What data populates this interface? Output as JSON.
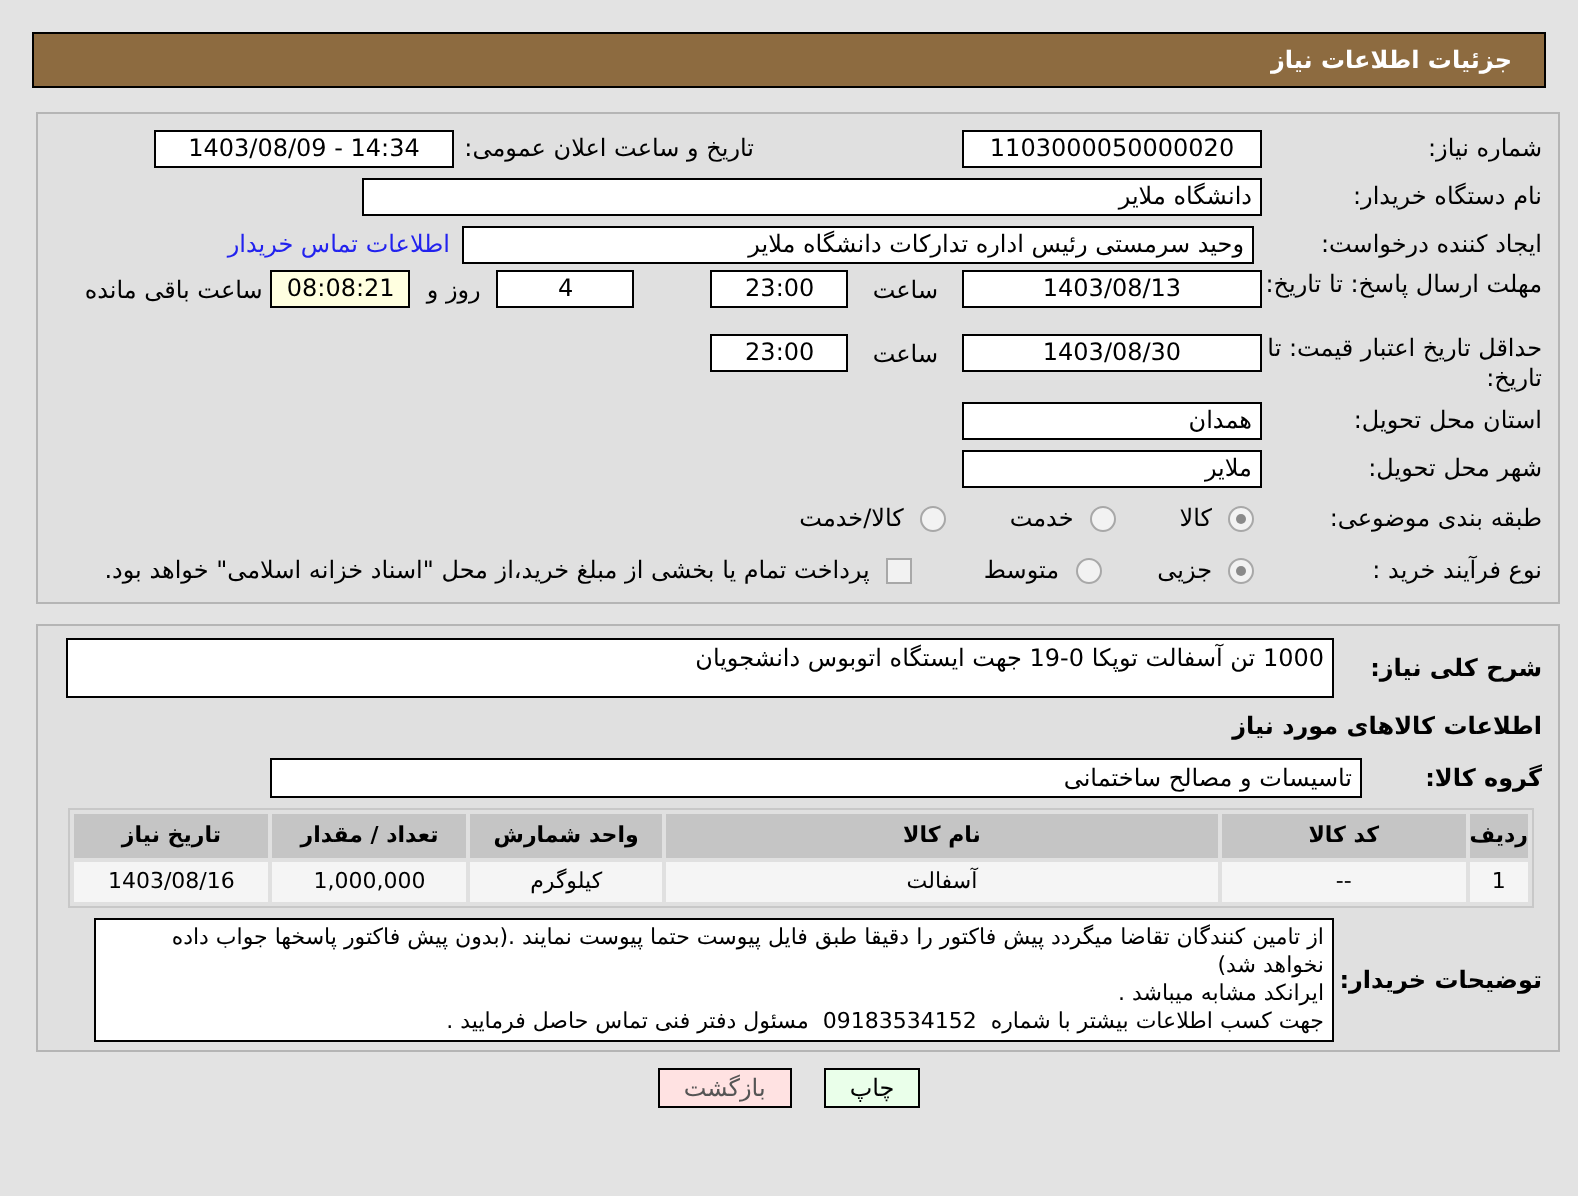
{
  "header": {
    "title": "جزئیات اطلاعات نیاز"
  },
  "need_number": {
    "label": "شماره نیاز:",
    "value": "1103000050000020"
  },
  "announce": {
    "label": "تاریخ و ساعت اعلان عمومی:",
    "value": "1403/08/09 - 14:34"
  },
  "buyer_org": {
    "label": "نام دستگاه خریدار:",
    "value": "دانشگاه ملایر"
  },
  "requester": {
    "label": "ایجاد کننده درخواست:",
    "value": "وحید سرمستی رئیس اداره تدارکات دانشگاه ملایر",
    "link": "اطلاعات تماس خریدار"
  },
  "response_deadline": {
    "label": "مهلت ارسال پاسخ: تا تاریخ:",
    "date": "1403/08/13",
    "time_label": "ساعت",
    "time": "23:00",
    "days": "4",
    "days_label": "روز و",
    "remaining": "08:08:21",
    "remaining_label": "ساعت باقی مانده"
  },
  "price_validity": {
    "label": "حداقل تاریخ اعتبار قیمت: تا تاریخ:",
    "date": "1403/08/30",
    "time_label": "ساعت",
    "time": "23:00"
  },
  "province": {
    "label": "استان محل تحویل:",
    "value": "همدان"
  },
  "city": {
    "label": "شهر محل تحویل:",
    "value": "ملایر"
  },
  "category": {
    "label": "طبقه بندی موضوعی:",
    "options": [
      {
        "label": "کالا",
        "selected": true
      },
      {
        "label": "خدمت",
        "selected": false
      },
      {
        "label": "کالا/خدمت",
        "selected": false
      }
    ]
  },
  "purchase_type": {
    "label": "نوع فرآیند خرید :",
    "options": [
      {
        "label": "جزیی",
        "selected": true
      },
      {
        "label": "متوسط",
        "selected": false
      }
    ],
    "payment": {
      "label": "پرداخت تمام یا بخشی از مبلغ خرید،از محل \"اسناد خزانه اسلامی\" خواهد بود.",
      "checked": false
    }
  },
  "description": {
    "label": "شرح کلی نیاز:",
    "value": "1000 تن آسفالت توپکا 0-19 جهت ایستگاه اتوبوس دانشجویان"
  },
  "items_section": {
    "title": "اطلاعات کالاهای مورد نیاز",
    "group": {
      "label": "گروه کالا:",
      "value": "تاسیسات و مصالح ساختمانی"
    },
    "table": {
      "columns": [
        "ردیف",
        "کد کالا",
        "نام کالا",
        "واحد شمارش",
        "تعداد / مقدار",
        "تاریخ نیاز"
      ],
      "rows": [
        [
          "1",
          "--",
          "آسفالت",
          "کیلوگرم",
          "1,000,000",
          "1403/08/16"
        ]
      ]
    }
  },
  "buyer_notes": {
    "label": "توضیحات خریدار:",
    "lines": [
      "از تامین کنندگان تقاضا میگردد پیش فاکتور را دقیقا طبق فایل پیوست حتما پیوست نمایند .(بدون پیش فاکتور پاسخها جواب داده نخواهد شد)",
      "ایرانکد مشابه میباشد .",
      "جهت کسب اطلاعات بیشتر با شماره  09183534152  مسئول دفتر فنی تماس حاصل فرمایید ."
    ]
  },
  "buttons": [
    {
      "label": "چاپ",
      "kind": "print"
    },
    {
      "label": "بازگشت",
      "kind": "back"
    }
  ]
}
